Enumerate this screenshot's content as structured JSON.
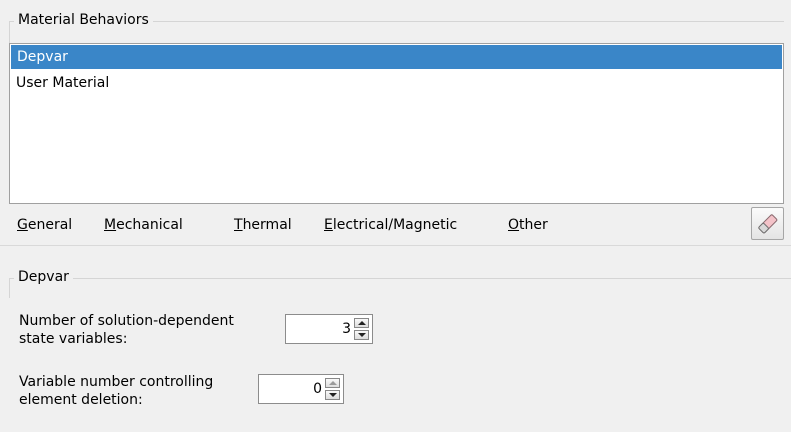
{
  "material_behaviors": {
    "group_title": "Material Behaviors",
    "items": [
      {
        "label": "Depvar",
        "selected": true
      },
      {
        "label": "User Material",
        "selected": false
      }
    ],
    "selection_color": "#3a86c8"
  },
  "menubar": {
    "items": [
      {
        "mnemonic": "G",
        "rest": "eneral"
      },
      {
        "mnemonic": "M",
        "rest": "echanical"
      },
      {
        "mnemonic": "T",
        "rest": "hermal"
      },
      {
        "mnemonic": "E",
        "rest": "lectrical/Magnetic"
      },
      {
        "mnemonic": "O",
        "rest": "ther"
      }
    ],
    "eraser_icon": "eraser-icon"
  },
  "depvar": {
    "group_title": "Depvar",
    "num_state_vars": {
      "label_line1": "Number of solution-dependent",
      "label_line2": "state variables:",
      "value": "3"
    },
    "deletion_var": {
      "label_line1": "Variable number controlling",
      "label_line2": "element deletion:",
      "value": "0"
    }
  }
}
